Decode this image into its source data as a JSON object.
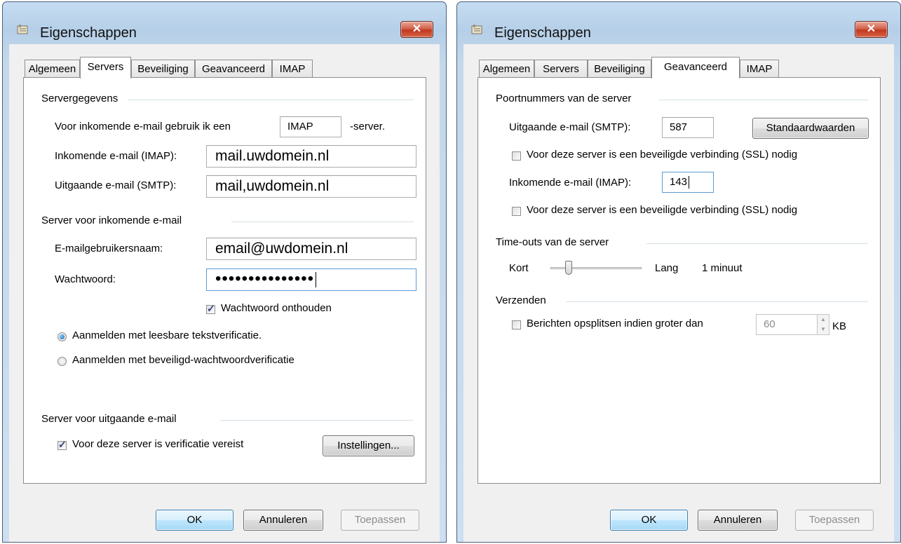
{
  "window1": {
    "title": "Eigenschappen",
    "close_glyph": "✕",
    "tabs": [
      "Algemeen",
      "Servers",
      "Beveiliging",
      "Geavanceerd",
      "IMAP"
    ],
    "active_tab": "Servers",
    "server_info": {
      "group_label": "Servergegevens",
      "incoming_type_label": "Voor inkomende e-mail gebruik ik een",
      "incoming_type_value": "IMAP",
      "incoming_type_suffix": "-server.",
      "incoming_label": "Inkomende e-mail (IMAP):",
      "incoming_value": "mail.uwdomein.nl",
      "outgoing_label": "Uitgaande e-mail (SMTP):",
      "outgoing_value": "mail,uwdomein.nl"
    },
    "incoming_server": {
      "group_label": "Server voor inkomende e-mail",
      "username_label": "E-mailgebruikersnaam:",
      "username_value": "email@uwdomein.nl",
      "password_label": "Wachtwoord:",
      "password_value": "•••••••••••••••",
      "remember_label": "Wachtwoord onthouden",
      "remember_checked": true,
      "radio_plain_label": "Aanmelden met leesbare tekstverificatie.",
      "radio_secure_label": "Aanmelden met beveiligd-wachtwoordverificatie",
      "selected_radio": "plain"
    },
    "outgoing_server": {
      "group_label": "Server voor uitgaande e-mail",
      "auth_label": "Voor deze server is verificatie vereist",
      "auth_checked": true,
      "settings_button": "Instellingen..."
    },
    "buttons": {
      "ok": "OK",
      "cancel": "Annuleren",
      "apply": "Toepassen"
    }
  },
  "window2": {
    "title": "Eigenschappen",
    "close_glyph": "✕",
    "tabs": [
      "Algemeen",
      "Servers",
      "Beveiliging",
      "Geavanceerd",
      "IMAP"
    ],
    "active_tab": "Geavanceerd",
    "ports": {
      "group_label": "Poortnummers van de server",
      "outgoing_label": "Uitgaande e-mail (SMTP):",
      "outgoing_value": "587",
      "defaults_button": "Standaardwaarden",
      "ssl_label_1": "Voor deze server is een beveiligde verbinding (SSL) nodig",
      "ssl_checked_1": false,
      "incoming_label": "Inkomende e-mail (IMAP):",
      "incoming_value": "143",
      "ssl_label_2": "Voor deze server is een beveiligde verbinding (SSL) nodig",
      "ssl_checked_2": false
    },
    "timeouts": {
      "group_label": "Time-outs van de server",
      "short_label": "Kort",
      "long_label": "Lang",
      "value_label": "1 minuut",
      "slider_fraction": 0.2
    },
    "sending": {
      "group_label": "Verzenden",
      "split_label": "Berichten opsplitsen indien groter dan",
      "split_checked": false,
      "split_value": "60",
      "unit": "KB"
    },
    "buttons": {
      "ok": "OK",
      "cancel": "Annuleren",
      "apply": "Toepassen"
    }
  },
  "icons": {
    "app": "properties-icon",
    "close": "close-icon",
    "check": "check-icon"
  },
  "colors": {
    "close_button": "#c1381f",
    "frame": "#b6cfe8",
    "focus": "#5b9bd5"
  }
}
